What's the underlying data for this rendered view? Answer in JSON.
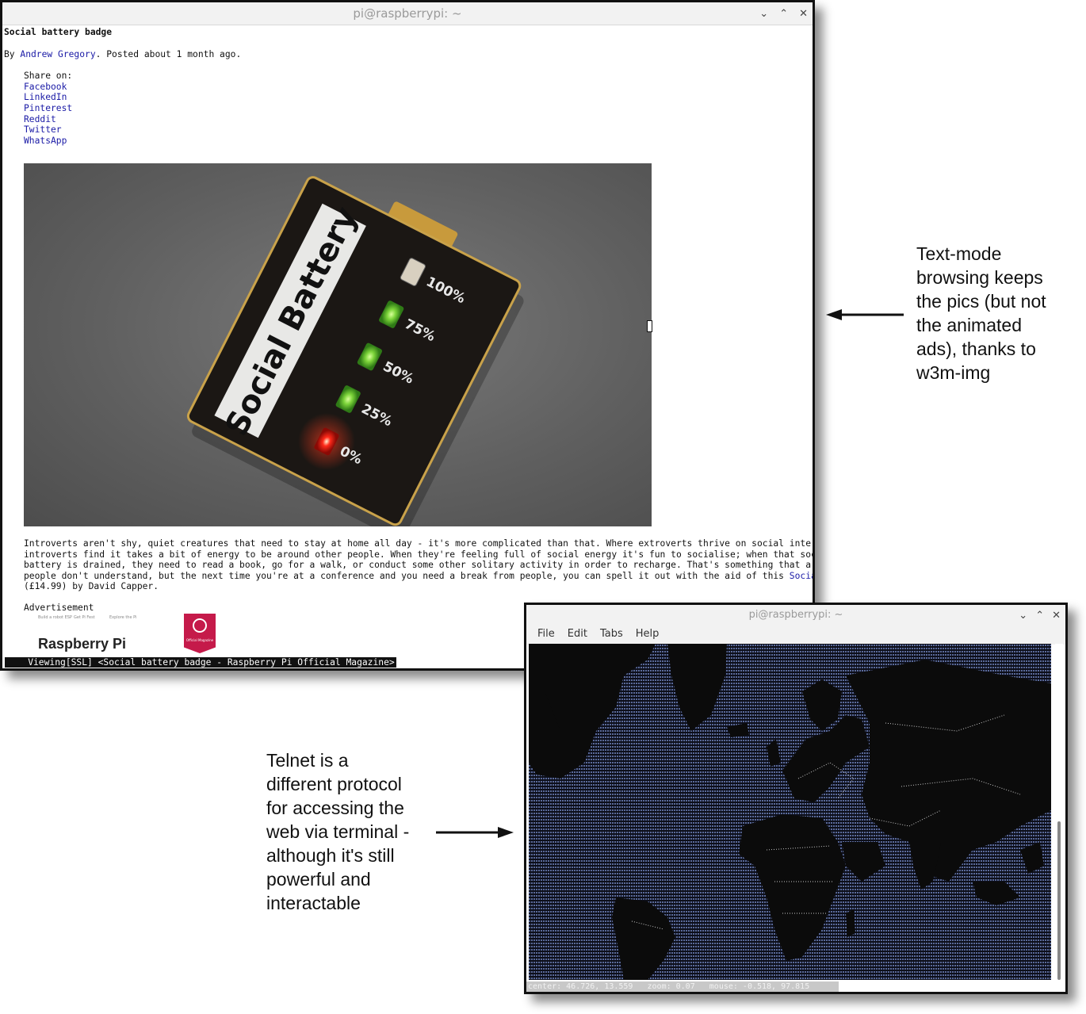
{
  "browser_window": {
    "title": "pi@raspberrypi: ~",
    "controls": {
      "minimize": "⌄",
      "maximize": "⌃",
      "close": "✕"
    },
    "article_title": "Social battery badge",
    "byline_prefix": "By ",
    "author": "Andrew Gregory",
    "byline_suffix": ". Posted about 1 month ago.",
    "share_label": "Share on:",
    "share_links": [
      "Facebook",
      "LinkedIn",
      "Pinterest",
      "Reddit",
      "Twitter",
      "WhatsApp"
    ],
    "image": {
      "badge_text": "Social Battery",
      "levels": [
        "100%",
        "75%",
        "50%",
        "25%",
        "0%"
      ]
    },
    "body_lines": [
      "Introverts aren't shy, quiet creatures that need to stay at home all day - it's more complicated than that. Where extroverts thrive on social interaction,",
      "introverts find it takes a bit of energy to be around other people. When they're feeling full of social energy it's fun to socialise; when that social",
      "battery is drained, they need to read a book, go for a walk, or conduct some other solitary activity in order to recharge. That's something that a lot of",
      "people don't understand, but the next time you're at a conference and you need a break from people, you can spell it out with the aid of this "
    ],
    "body_link": "Social Battery",
    "body_last": "(£14.99) by David Capper.",
    "advertisement_label": "Advertisement",
    "ad_brand": "Raspberry Pi",
    "ad_small_texts": [
      "Build a robot ESP",
      "Get Pi Fest",
      "Explore the Pi"
    ],
    "ad_badge_text": "Official Magazine",
    "status_line": "    Viewing[SSL] <Social battery badge - Raspberry Pi Official Magazine>"
  },
  "telnet_window": {
    "title": "pi@raspberrypi: ~",
    "controls": {
      "minimize": "⌄",
      "maximize": "⌃",
      "close": "✕"
    },
    "menu": [
      "File",
      "Edit",
      "Tabs",
      "Help"
    ],
    "status_line": "center: 46.726, 13.559   zoom: 0.07   mouse: -0.518, 97.815"
  },
  "annotations": {
    "top_right": [
      "Text-mode",
      "browsing keeps",
      "the pics (but not",
      "the animated",
      "ads), thanks to",
      "w3m-img"
    ],
    "bottom_left": [
      "Telnet is a",
      "different protocol",
      "for accessing the",
      "web via terminal -",
      "although it's still",
      "powerful and",
      "interactable"
    ]
  },
  "colors": {
    "link": "#1a1aa6",
    "map_ocean": "#4a5a86",
    "map_land": "#0b0b0b",
    "led_green": "#7cd43a",
    "led_red": "#ff2a1a"
  }
}
